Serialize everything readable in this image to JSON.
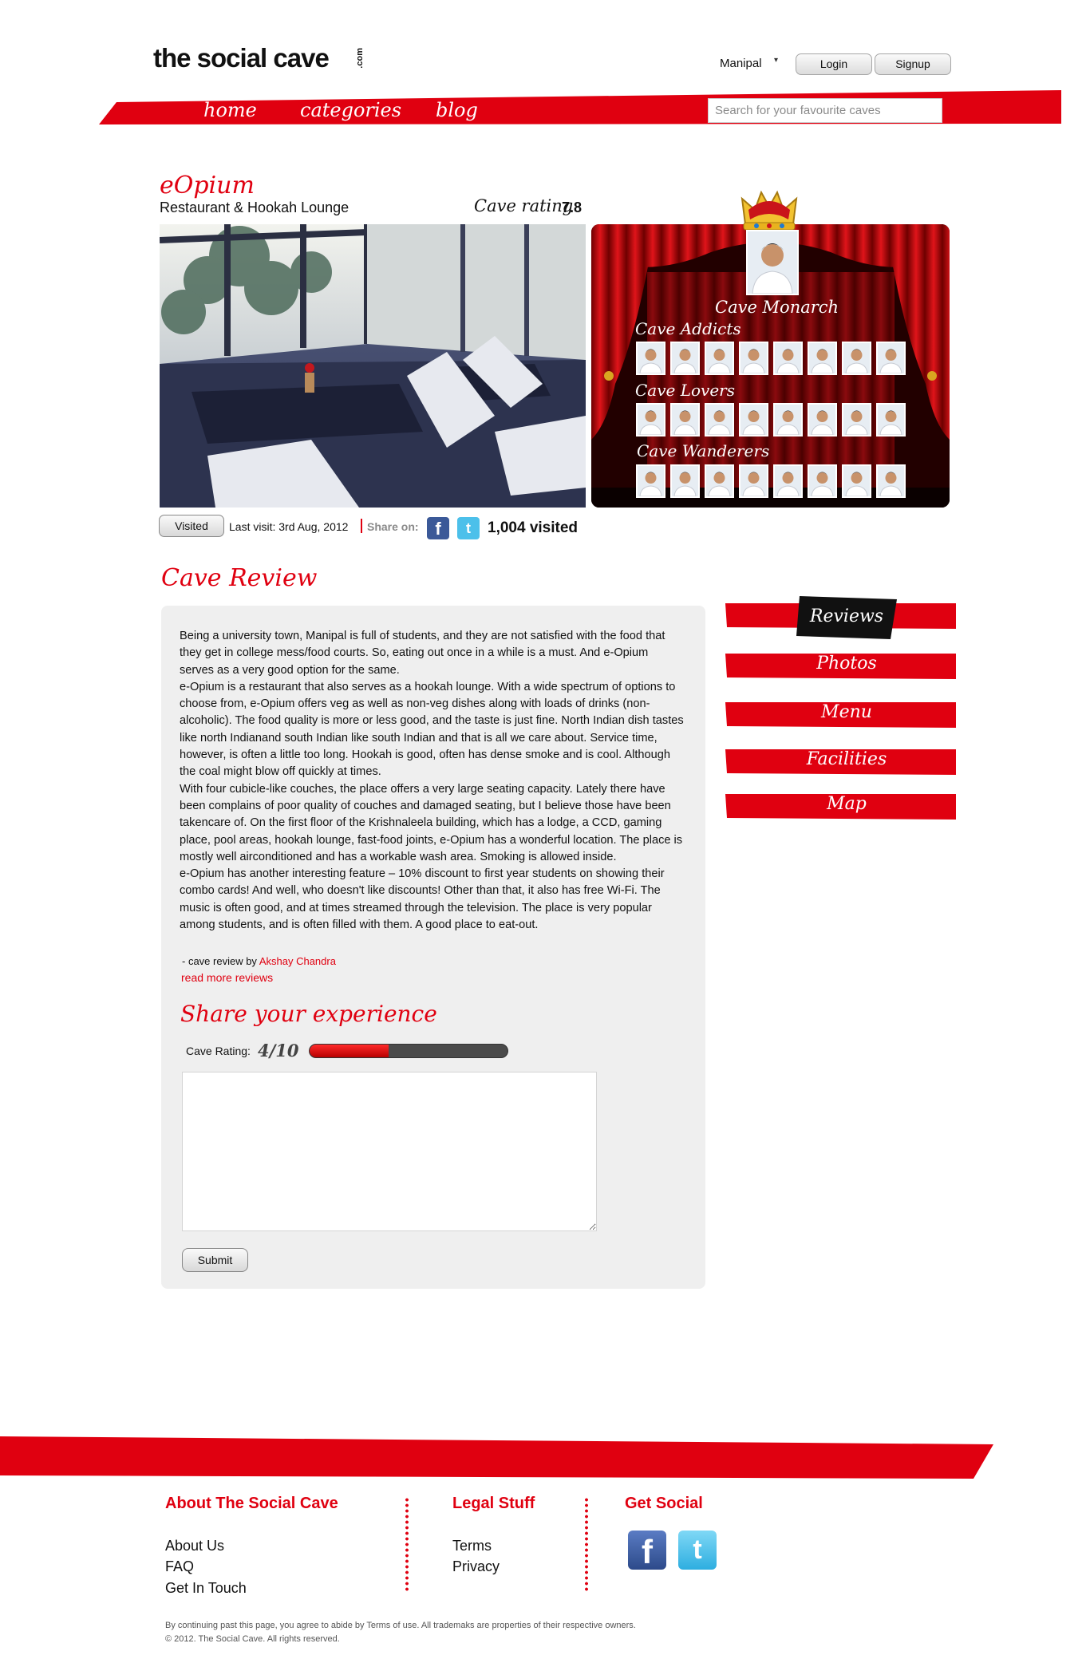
{
  "header": {
    "logo": "the social cave",
    "logo_suffix": ".com",
    "city": "Manipal",
    "login_label": "Login",
    "signup_label": "Signup",
    "nav": [
      "home",
      "categories",
      "blog"
    ],
    "search_placeholder": "Search for your favourite caves"
  },
  "cave": {
    "name": "eOpium",
    "type": "Restaurant & Hookah Lounge",
    "rating_label": "Cave rating",
    "rating_value": "7.8",
    "monarch_label": "Cave Monarch",
    "tiers": {
      "addicts": "Cave Addicts",
      "lovers": "Cave Lovers",
      "wanderers": "Cave Wanderers"
    }
  },
  "visit": {
    "visited_label": "Visited",
    "last_visit": "Last visit: 3rd Aug, 2012",
    "share_on": "Share on:",
    "visited_count": "1,004 visited"
  },
  "review": {
    "heading": "Cave Review",
    "paragraphs": [
      "Being a university town, Manipal is full of students, and they are not satisfied with the food that they get in college mess/food courts. So, eating out once in a while is a must. And e-Opium serves as a very good option for the same.",
      "e-Opium is a restaurant that also serves as a hookah lounge. With a wide spectrum of options to choose from, e-Opium offers veg as well as non-veg dishes along with loads of drinks (non-alcoholic). The food quality is more or less good, and the taste is just fine. North Indian dish tastes like north Indianand south Indian like south Indian and that is all we care about. Service time, however, is often a little too long. Hookah is good, often has dense smoke and is cool. Although the coal might blow off quickly at times.",
      "With four cubicle-like couches, the place offers a very large seating capacity. Lately there have been complains of poor quality of couches and damaged seating, but I believe those have been takencare of. On the first floor of the Krishnaleela building, which has a lodge, a CCD, gaming place, pool areas, hookah lounge, fast-food joints, e-Opium has a wonderful location. The place is mostly well airconditioned and has a workable wash area. Smoking is allowed inside.",
      "e-Opium has another interesting feature – 10% discount to first year students on showing their combo cards! And well, who doesn't like discounts! Other than that, it also has free Wi-Fi. The music is often good, and at times streamed through the television. The place is very popular among students, and is often filled with them. A good place to eat-out."
    ],
    "by_prefix": "- cave review by",
    "author": "Akshay Chandra",
    "more_link": "read more reviews"
  },
  "share_experience": {
    "heading": "Share your experience",
    "rating_label": "Cave Rating:",
    "rating_value": "4/10",
    "rating_fraction": 0.4,
    "submit_label": "Submit"
  },
  "side_tabs": [
    "Reviews",
    "Photos",
    "Menu",
    "Facilities",
    "Map"
  ],
  "footer": {
    "about_heading": "About The Social Cave",
    "about_links": [
      "About Us",
      "FAQ",
      "Get In Touch"
    ],
    "legal_heading": "Legal Stuff",
    "legal_links": [
      "Terms",
      "Privacy"
    ],
    "social_heading": "Get Social",
    "legal_note": "By continuing past this page, you agree to abide by Terms of use. All trademaks are properties of their respective owners.",
    "copyright": "© 2012. The Social Cave. All rights reserved."
  },
  "colors": {
    "accent": "#e00010",
    "panel": "#efefef",
    "facebook": "#3b5998",
    "twitter": "#4cc0ea"
  }
}
